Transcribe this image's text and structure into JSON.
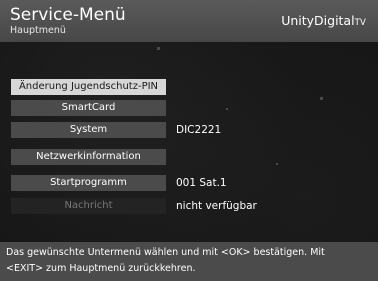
{
  "header": {
    "title": "Service-Menü",
    "subtitle": "Hauptmenü",
    "brand_main": "UnityDigital",
    "brand_tv": "TV"
  },
  "menu": {
    "items": [
      {
        "label": "Änderung Jugendschutz-PIN",
        "value": "",
        "state": "selected"
      },
      {
        "label": "SmartCard",
        "value": "",
        "state": "normal"
      },
      {
        "label": "System",
        "value": "DIC2221",
        "state": "normal"
      },
      {
        "label": "Netzwerkinformation",
        "value": "",
        "state": "normal"
      },
      {
        "label": "Startprogramm",
        "value": "001 Sat.1",
        "state": "normal"
      },
      {
        "label": "Nachricht",
        "value": "nicht verfügbar",
        "state": "disabled"
      }
    ]
  },
  "footer": {
    "line1": "Das gewünschte Untermenü wählen und mit <OK> bestätigen. Mit",
    "line2": "<EXIT> zum Hauptmenü zurückkehren."
  },
  "colors": {
    "header_bg": "#4f4f4f",
    "button_bg": "#4b4b4b",
    "selected_bg": "#d7d7d7",
    "disabled_bg": "#232323",
    "screen_bg": "#161616"
  }
}
